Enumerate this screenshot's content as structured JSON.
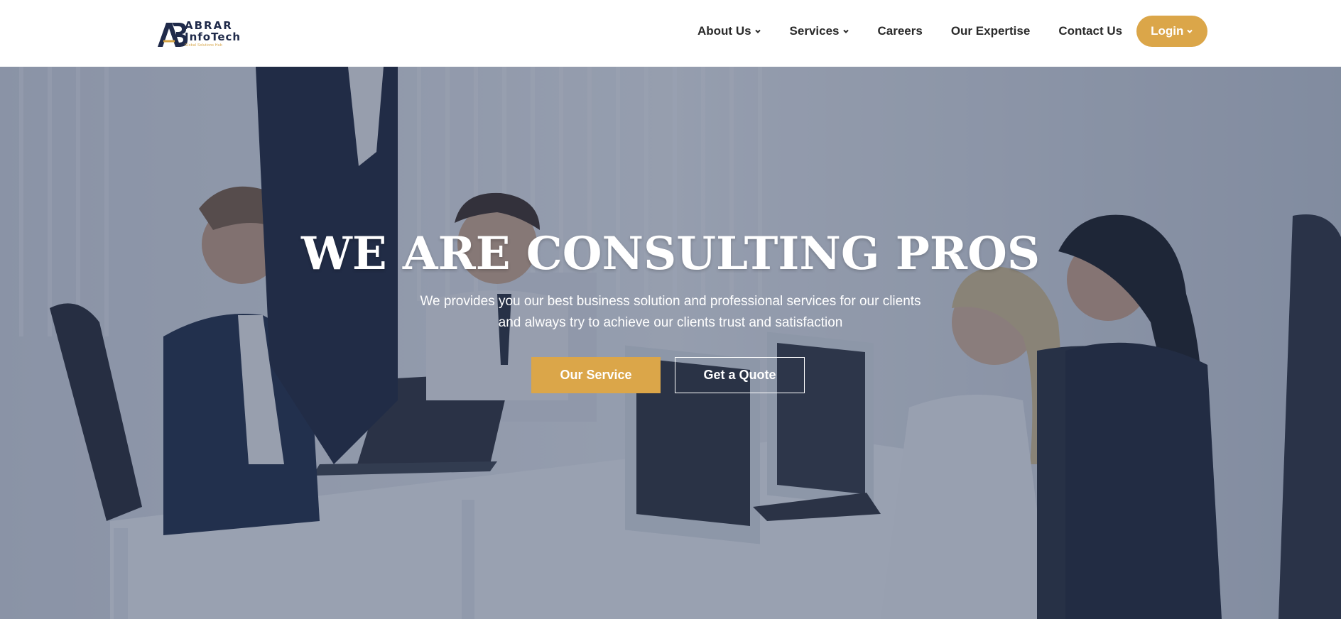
{
  "brand": {
    "name_line1": "ABRAR",
    "name_line2": "InfoTech",
    "tagline": "Global Solutions Hub",
    "logo_icon": "ab-monogram-icon",
    "colors": {
      "navy": "#1f2a4a",
      "gold": "#dba649"
    }
  },
  "nav": {
    "items": [
      {
        "label": "About Us",
        "has_dropdown": true
      },
      {
        "label": "Services",
        "has_dropdown": true
      },
      {
        "label": "Careers",
        "has_dropdown": false
      },
      {
        "label": "Our Expertise",
        "has_dropdown": false
      },
      {
        "label": "Contact Us",
        "has_dropdown": false
      }
    ],
    "login_label": "Login"
  },
  "hero": {
    "title": "WE ARE CONSULTING PROS",
    "subtitle_line1": "We provides you our best business solution and professional services for our clients",
    "subtitle_line2": "and always try to achieve our clients trust and satisfaction",
    "primary_button": "Our Service",
    "secondary_button": "Get a Quote",
    "background": "office-team-at-computers-photo",
    "overlay_color": "#2a3a5c"
  }
}
